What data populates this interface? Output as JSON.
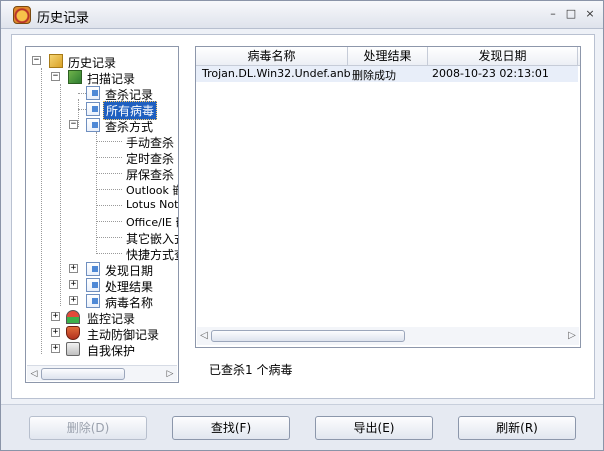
{
  "window": {
    "title": "历史记录",
    "minimize_glyph": "–",
    "maximize_glyph": "□",
    "close_glyph": "×"
  },
  "tree": {
    "root": "历史记录",
    "scan_records": "扫描记录",
    "query_records": "查杀记录",
    "all_viruses": "所有病毒",
    "scan_methods": "查杀方式",
    "methods": [
      "手动查杀",
      "定时查杀",
      "屏保查杀",
      "Outlook 嵌",
      "Lotus Note",
      "Office/IE 嵌",
      "其它嵌入式",
      "快捷方式查"
    ],
    "found_date": "发现日期",
    "process_result": "处理结果",
    "virus_name": "病毒名称",
    "monitor_records": "监控记录",
    "active_defense": "主动防御记录",
    "self_protect": "自我保护",
    "expand_glyph": "+",
    "collapse_glyph": "−"
  },
  "list": {
    "columns": [
      "病毒名称",
      "处理结果",
      "发现日期"
    ],
    "rows": [
      [
        "Trojan.DL.Win32.Undef.anb",
        "删除成功",
        "2008-10-23 02:13:01"
      ]
    ]
  },
  "status": "已查杀1 个病毒",
  "buttons": {
    "delete": "删除(D)",
    "find": "查找(F)",
    "export": "导出(E)",
    "refresh": "刷新(R)"
  },
  "scroll": {
    "left_arrow": "◁",
    "right_arrow": "▷"
  }
}
